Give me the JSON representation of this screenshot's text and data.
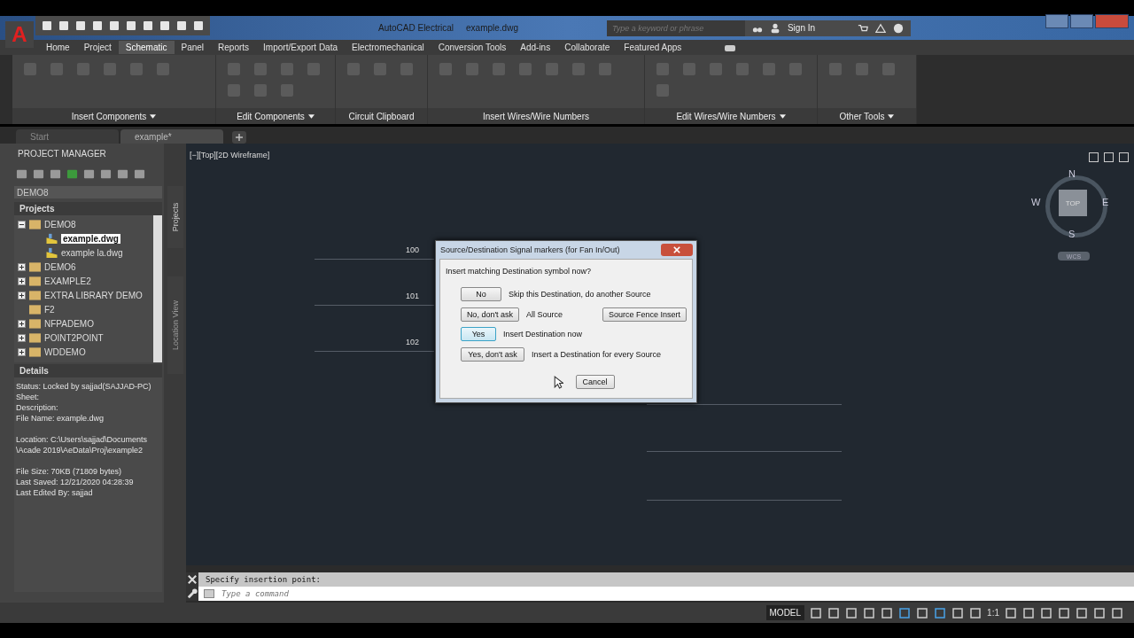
{
  "app": {
    "logo": "A",
    "title": "AutoCAD Electrical",
    "file": "example.dwg"
  },
  "search": {
    "placeholder": "Type a keyword or phrase"
  },
  "sign_in": "Sign In",
  "ribbon_tabs": [
    {
      "label": "Home",
      "selected": false
    },
    {
      "label": "Project",
      "selected": false
    },
    {
      "label": "Schematic",
      "selected": true
    },
    {
      "label": "Panel",
      "selected": false
    },
    {
      "label": "Reports",
      "selected": false
    },
    {
      "label": "Import/Export Data",
      "selected": false
    },
    {
      "label": "Electromechanical",
      "selected": false
    },
    {
      "label": "Conversion Tools",
      "selected": false
    },
    {
      "label": "Add-ins",
      "selected": false
    },
    {
      "label": "Collaborate",
      "selected": false
    },
    {
      "label": "Featured Apps",
      "selected": false
    }
  ],
  "ribbon_panels": [
    {
      "label": "Insert Components",
      "menu": true
    },
    {
      "label": "Edit Components",
      "menu": true
    },
    {
      "label": "Circuit Clipboard",
      "menu": false
    },
    {
      "label": "Insert Wires/Wire Numbers",
      "menu": false
    },
    {
      "label": "Edit Wires/Wire Numbers",
      "menu": true
    },
    {
      "label": "Other Tools",
      "menu": true
    }
  ],
  "doc_tabs": [
    {
      "label": "Start",
      "selected": false
    },
    {
      "label": "example*",
      "selected": true
    }
  ],
  "project_manager": {
    "title": "PROJECT MANAGER",
    "project_select": "DEMO8",
    "projects_title": "Projects",
    "tree": [
      {
        "label": "DEMO8",
        "expanded": true,
        "children": [
          {
            "label": "example.dwg",
            "selected": true
          },
          {
            "label": "example la.dwg",
            "selected": false
          }
        ]
      },
      {
        "label": "DEMO6",
        "expanded": false
      },
      {
        "label": "EXAMPLE2",
        "expanded": false
      },
      {
        "label": "EXTRA LIBRARY DEMO",
        "expanded": false
      },
      {
        "label": "F2"
      },
      {
        "label": "NFPADEMO",
        "expanded": false
      },
      {
        "label": "POINT2POINT",
        "expanded": false
      },
      {
        "label": "WDDEMO",
        "expanded": false
      }
    ]
  },
  "side_tabs": [
    {
      "label": "Projects",
      "selected": true
    },
    {
      "label": "Location View",
      "selected": false
    }
  ],
  "details": {
    "title": "Details",
    "groups": [
      [
        "Status: Locked by sajjad(SAJJAD-PC)",
        "Sheet:",
        "Description:",
        "File Name: example.dwg"
      ],
      [
        "Location: C:\\Users\\sajjad\\Documents",
        "\\Acade 2019\\AeData\\Proj\\example2"
      ],
      [
        "File Size: 70KB (71809 bytes)",
        "Last Saved: 12/21/2020 04:28:39",
        "Last Edited By: sajjad"
      ]
    ]
  },
  "viewport_label": "[−][Top][2D Wireframe]",
  "wires": [
    {
      "label": "100"
    },
    {
      "label": "101"
    },
    {
      "label": "102"
    }
  ],
  "viewcube": {
    "top": "TOP",
    "north": "N",
    "south": "S",
    "east": "E",
    "west": "W",
    "ucs": "WCS"
  },
  "dialog": {
    "title": "Source/Destination Signal markers (for Fan In/Out)",
    "prompt": "Insert matching Destination symbol now?",
    "options": [
      {
        "button": "No",
        "text": "Skip this Destination, do another Source",
        "focused": false
      },
      {
        "button": "No, don't ask",
        "text": "All Source",
        "focused": false
      },
      {
        "button": "Yes",
        "text": "Insert Destination now",
        "focused": true
      },
      {
        "button": "Yes, don't ask",
        "text": "Insert a Destination for every Source",
        "focused": false
      }
    ],
    "fence_button": "Source Fence Insert",
    "cancel": "Cancel"
  },
  "command": {
    "history": "Specify insertion point:",
    "placeholder": "Type a command"
  },
  "status_bar": {
    "model": "MODEL",
    "scale": "1:1"
  }
}
